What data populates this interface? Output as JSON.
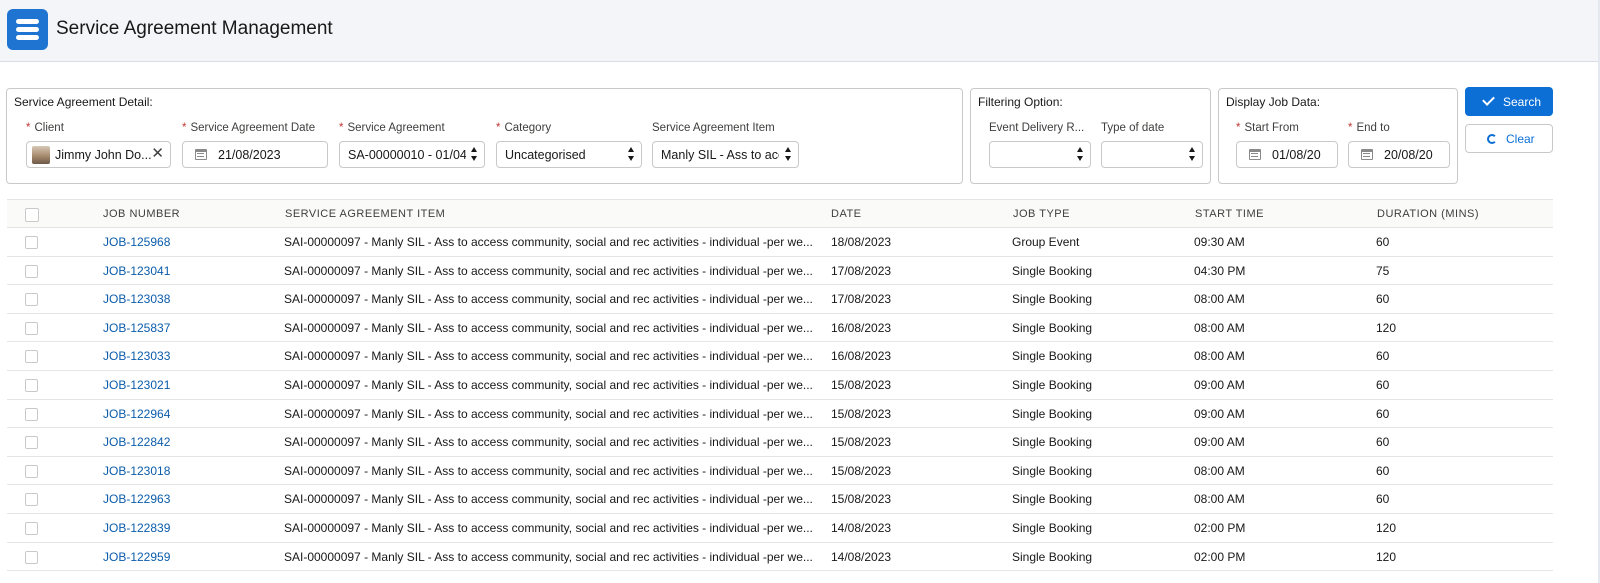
{
  "app": {
    "title": "Service Agreement Management",
    "icon": "list-app-icon"
  },
  "service_agreement_detail": {
    "title": "Service Agreement Detail:",
    "client": {
      "label": "Client",
      "value": "Jimmy John Do..."
    },
    "date": {
      "label": "Service Agreement Date",
      "value": "21/08/2023"
    },
    "agreement": {
      "label": "Service Agreement",
      "value": "SA-00000010 - 01/04"
    },
    "category": {
      "label": "Category",
      "value": "Uncategorised"
    },
    "item": {
      "label": "Service Agreement Item",
      "value": "Manly SIL - Ass to acce"
    }
  },
  "filtering": {
    "title": "Filtering Option:",
    "event_delivery": {
      "label": "Event Delivery R...",
      "value": ""
    },
    "type_of_date": {
      "label": "Type of date",
      "value": ""
    }
  },
  "display_job": {
    "title": "Display Job Data:",
    "start_from": {
      "label": "Start From",
      "value": "01/08/20"
    },
    "end_to": {
      "label": "End to",
      "value": "20/08/20"
    }
  },
  "buttons": {
    "search": "Search",
    "clear": "Clear"
  },
  "colors": {
    "brand": "#0b6fd6",
    "link": "#0b5cab",
    "required": "#c23934"
  },
  "table": {
    "columns": [
      "JOB NUMBER",
      "SERVICE AGREEMENT ITEM",
      "DATE",
      "JOB TYPE",
      "START TIME",
      "DURATION (MINS)"
    ],
    "rows": [
      [
        "JOB-125968",
        "SAI-00000097 - Manly SIL - Ass to access community, social and rec activities - individual -per we...",
        "18/08/2023",
        "Group Event",
        "09:30 AM",
        "60"
      ],
      [
        "JOB-123041",
        "SAI-00000097 - Manly SIL - Ass to access community, social and rec activities - individual -per we...",
        "17/08/2023",
        "Single Booking",
        "04:30 PM",
        "75"
      ],
      [
        "JOB-123038",
        "SAI-00000097 - Manly SIL - Ass to access community, social and rec activities - individual -per we...",
        "17/08/2023",
        "Single Booking",
        "08:00 AM",
        "60"
      ],
      [
        "JOB-125837",
        "SAI-00000097 - Manly SIL - Ass to access community, social and rec activities - individual -per we...",
        "16/08/2023",
        "Single Booking",
        "08:00 AM",
        "120"
      ],
      [
        "JOB-123033",
        "SAI-00000097 - Manly SIL - Ass to access community, social and rec activities - individual -per we...",
        "16/08/2023",
        "Single Booking",
        "08:00 AM",
        "60"
      ],
      [
        "JOB-123021",
        "SAI-00000097 - Manly SIL - Ass to access community, social and rec activities - individual -per we...",
        "15/08/2023",
        "Single Booking",
        "09:00 AM",
        "60"
      ],
      [
        "JOB-122964",
        "SAI-00000097 - Manly SIL - Ass to access community, social and rec activities - individual -per we...",
        "15/08/2023",
        "Single Booking",
        "09:00 AM",
        "60"
      ],
      [
        "JOB-122842",
        "SAI-00000097 - Manly SIL - Ass to access community, social and rec activities - individual -per we...",
        "15/08/2023",
        "Single Booking",
        "09:00 AM",
        "60"
      ],
      [
        "JOB-123018",
        "SAI-00000097 - Manly SIL - Ass to access community, social and rec activities - individual -per we...",
        "15/08/2023",
        "Single Booking",
        "08:00 AM",
        "60"
      ],
      [
        "JOB-122963",
        "SAI-00000097 - Manly SIL - Ass to access community, social and rec activities - individual -per we...",
        "15/08/2023",
        "Single Booking",
        "08:00 AM",
        "60"
      ],
      [
        "JOB-122839",
        "SAI-00000097 - Manly SIL - Ass to access community, social and rec activities - individual -per we...",
        "14/08/2023",
        "Single Booking",
        "02:00 PM",
        "120"
      ],
      [
        "JOB-122959",
        "SAI-00000097 - Manly SIL - Ass to access community, social and rec activities - individual -per we...",
        "14/08/2023",
        "Single Booking",
        "02:00 PM",
        "120"
      ]
    ]
  }
}
